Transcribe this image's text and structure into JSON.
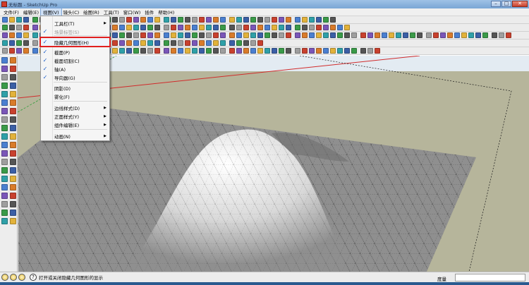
{
  "window": {
    "title": "无标题 - SketchUp Pro",
    "controls": {
      "minimize": "–",
      "maximize": "□",
      "close": "✕"
    }
  },
  "menubar": {
    "items": [
      "文件(F)",
      "编辑(E)",
      "视图(V)",
      "镜头(C)",
      "绘图(R)",
      "工具(T)",
      "窗口(W)",
      "插件",
      "帮助(H)"
    ],
    "active": "视图(V)"
  },
  "view_menu": {
    "items": [
      {
        "label": "工具栏(T)",
        "checked": false,
        "submenu": true,
        "disabled": false
      },
      {
        "label": "场景标签(S)",
        "checked": true,
        "submenu": false,
        "disabled": true
      },
      {
        "label": "隐藏几何图形(H)",
        "checked": true,
        "submenu": false,
        "disabled": false,
        "highlighted": true
      },
      {
        "label": "截面(P)",
        "checked": true,
        "submenu": false,
        "disabled": false
      },
      {
        "label": "截面切割(C)",
        "checked": true,
        "submenu": false,
        "disabled": false
      },
      {
        "label": "轴(A)",
        "checked": true,
        "submenu": false,
        "disabled": false
      },
      {
        "label": "导向器(G)",
        "checked": true,
        "submenu": false,
        "disabled": false
      },
      {
        "label": "阴影(D)",
        "checked": false,
        "submenu": false,
        "disabled": false
      },
      {
        "label": "雾化(F)",
        "checked": false,
        "submenu": false,
        "disabled": false
      },
      {
        "label": "边线样式(D)",
        "checked": false,
        "submenu": true,
        "disabled": false
      },
      {
        "label": "正面样式(Y)",
        "checked": false,
        "submenu": true,
        "disabled": false
      },
      {
        "label": "组件编辑(E)",
        "checked": false,
        "submenu": true,
        "disabled": false
      },
      {
        "label": "动画(N)",
        "checked": false,
        "submenu": true,
        "disabled": false
      }
    ],
    "check_glyph": "✓",
    "arrow_glyph": "▶"
  },
  "statusbar": {
    "help_glyph": "?",
    "text": "打开或关闭隐藏几何图形的显示",
    "measurements_label": "度量",
    "measurements_value": ""
  },
  "colors": {
    "viewport_ground": "#b6b59b",
    "viewport_sky": "#e3ebf2",
    "mesh_fill": "#8f8f8f",
    "axis_red": "#d12b2b",
    "axis_green": "#2f9d3a",
    "menu_highlight_outline": "#e02020"
  },
  "icons": {
    "toolbar_palette": [
      "#4a7fd0",
      "#c8412e",
      "#3a9a48",
      "#e2b23a",
      "#7a56b8",
      "#555555",
      "#2fa0a8",
      "#d97b2a",
      "#9e9e9e",
      "#3b5fa6"
    ]
  }
}
